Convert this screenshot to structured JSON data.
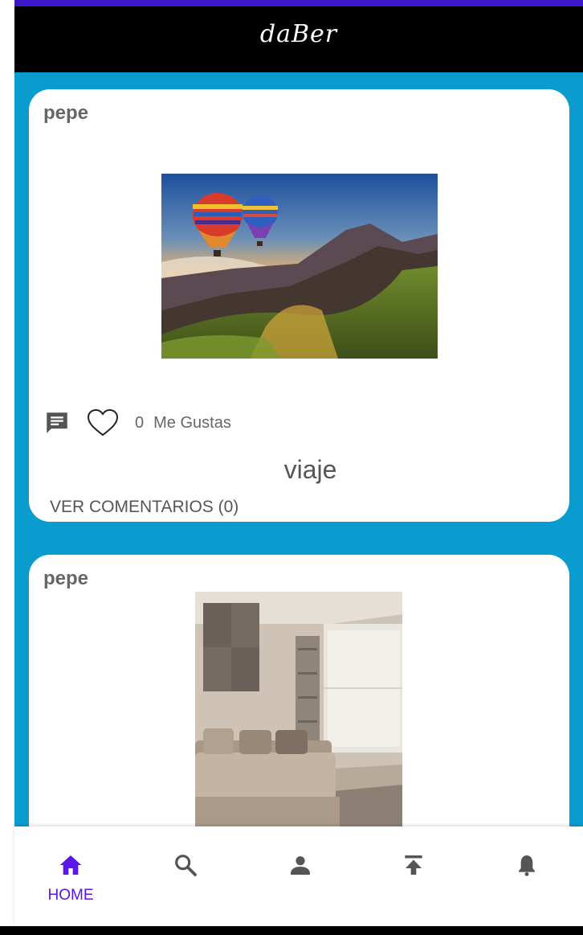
{
  "app": {
    "title": "daBer"
  },
  "colors": {
    "accent": "#5a15e8",
    "feed_background": "#0b9ccf",
    "app_bar": "#000000"
  },
  "posts": [
    {
      "author": "pepe",
      "image": "hot-air-balloons-over-mountains",
      "likes_count": "0",
      "likes_label": "Me Gustas",
      "caption": "viaje",
      "comments_link": "VER COMENTARIOS (0)"
    },
    {
      "author": "pepe",
      "image": "living-room-with-sofa"
    }
  ],
  "bottom_nav": {
    "items": [
      {
        "icon": "home-icon",
        "label": "HOME",
        "active": true
      },
      {
        "icon": "search-icon"
      },
      {
        "icon": "person-icon"
      },
      {
        "icon": "upload-icon"
      },
      {
        "icon": "bell-icon"
      }
    ]
  }
}
